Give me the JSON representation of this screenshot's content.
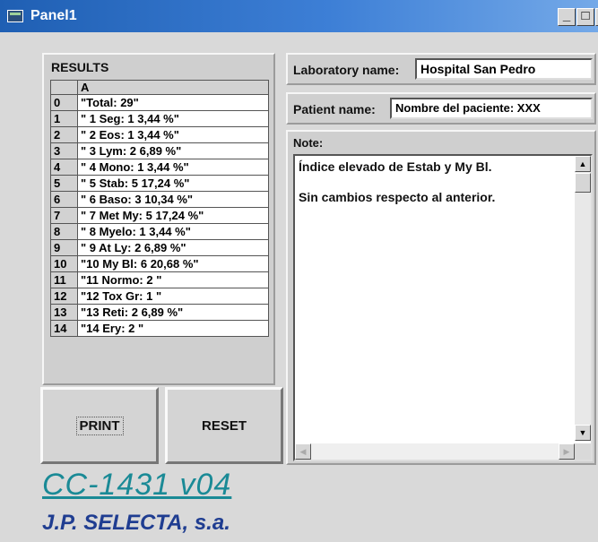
{
  "window": {
    "title": "Panel1"
  },
  "results": {
    "title": "RESULTS",
    "column_header": "A",
    "rows": [
      {
        "index": "0",
        "value": "\"Total:  29\""
      },
      {
        "index": "1",
        "value": "\" 1  Seg:     1     3,44 %\""
      },
      {
        "index": "2",
        "value": "\" 2  Eos:     1     3,44 %\""
      },
      {
        "index": "3",
        "value": "\" 3  Lym:     2     6,89 %\""
      },
      {
        "index": "4",
        "value": "\" 4  Mono:    1     3,44 %\""
      },
      {
        "index": "5",
        "value": "\" 5  Stab:    5   17,24 %\""
      },
      {
        "index": "6",
        "value": "\" 6  Baso:    3   10,34 %\""
      },
      {
        "index": "7",
        "value": "\" 7 Met My:   5   17,24 %\""
      },
      {
        "index": "8",
        "value": "\" 8  Myelo:   1     3,44 %\""
      },
      {
        "index": "9",
        "value": "\" 9  At Ly:   2    6,89 %\""
      },
      {
        "index": "10",
        "value": "\"10  My Bl:   6   20,68 %\""
      },
      {
        "index": "11",
        "value": "\"11  Normo:   2     \""
      },
      {
        "index": "12",
        "value": "\"12 Tox Gr:   1    \""
      },
      {
        "index": "13",
        "value": "\"13  Reti:    2    6,89 %\""
      },
      {
        "index": "14",
        "value": "\"14  Ery:     2    \""
      }
    ]
  },
  "buttons": {
    "print": "PRINT",
    "reset": "RESET"
  },
  "laboratory": {
    "label": "Laboratory name:",
    "value": "Hospital San Pedro"
  },
  "patient": {
    "label": "Patient name:",
    "value": "Nombre del paciente: XXX"
  },
  "note": {
    "label": "Note:",
    "lines": [
      "Índice elevado de Estab y My Bl.",
      "",
      "Sin cambios respecto al anterior."
    ]
  },
  "footer": {
    "model": "CC-1431 v04",
    "company": "J.P. SELECTA, s.a."
  },
  "colors": {
    "titlebar": "#2b6cc4",
    "model_text": "#1a8a96",
    "company_text": "#1f3d91"
  }
}
